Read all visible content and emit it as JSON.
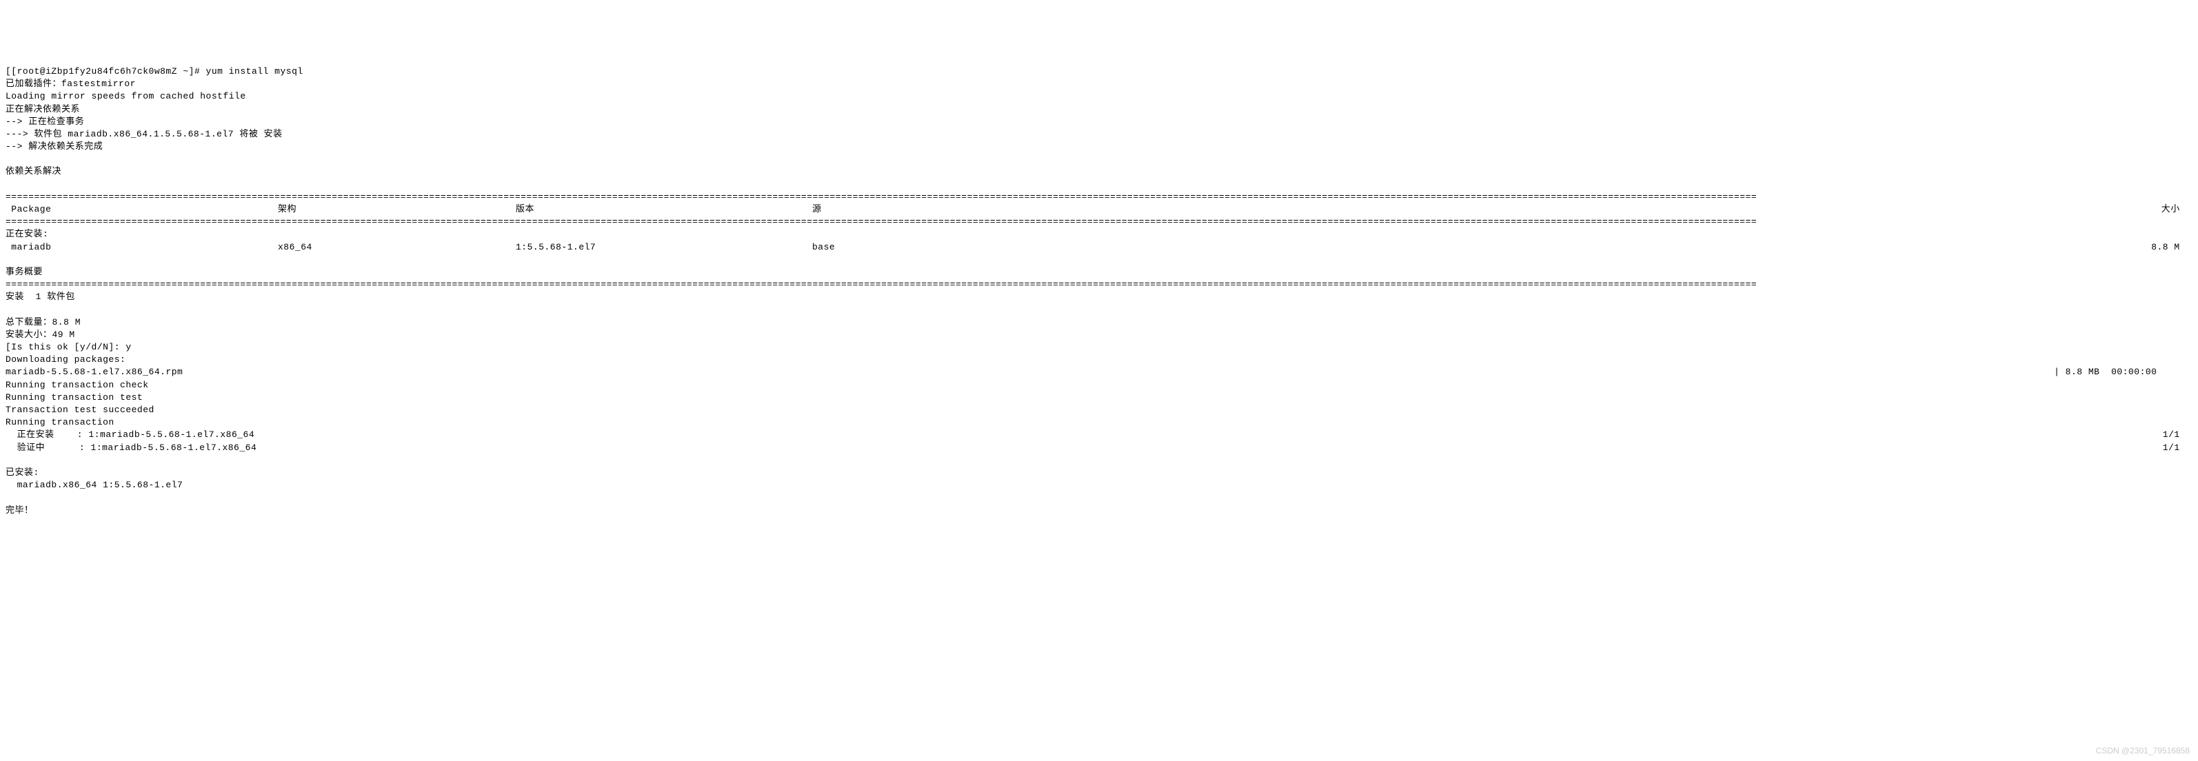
{
  "prompt": "[[root@iZbp1fy2u84fc6h7ck0w8mZ ~]# ",
  "command": "yum install mysql",
  "lines_pre": [
    "已加载插件：fastestmirror",
    "Loading mirror speeds from cached hostfile",
    "正在解决依赖关系",
    "--> 正在检查事务",
    "---> 软件包 mariadb.x86_64.1.5.5.68-1.el7 将被 安装",
    "--> 解决依赖关系完成",
    "",
    "依赖关系解决",
    ""
  ],
  "sep_heavy": "==================================================================================================================================================================================================================================================================================================================",
  "header": {
    "package": " Package",
    "arch": "架构",
    "version": "版本",
    "repo": "源",
    "size": "大小 "
  },
  "installing_label": "正在安装:",
  "pkg_row": {
    "package": " mariadb",
    "arch": "x86_64",
    "version": "1:5.5.68-1.el7",
    "repo": "base",
    "size": "8.8 M "
  },
  "summary_label": "事务概要",
  "install_count": "安装  1 软件包",
  "totals": [
    "",
    "总下载量：8.8 M",
    "安装大小：49 M"
  ],
  "confirm": "[Is this ok [y/d/N]: y",
  "downloading": "Downloading packages:",
  "dl_row": {
    "name": "mariadb-5.5.68-1.el7.x86_64.rpm",
    "stats": "| 8.8 MB  00:00:00     "
  },
  "transaction": [
    "Running transaction check",
    "Running transaction test",
    "Transaction test succeeded",
    "Running transaction"
  ],
  "install_step": {
    "left": "  正在安装    : 1:mariadb-5.5.68-1.el7.x86_64",
    "right": "1/1 "
  },
  "verify_step": {
    "left": "  验证中      : 1:mariadb-5.5.68-1.el7.x86_64",
    "right": "1/1 "
  },
  "installed_label": "已安装:",
  "installed_pkg": "  mariadb.x86_64 1:5.5.68-1.el7",
  "complete": "完毕！",
  "watermark": "CSDN @2301_79516858"
}
